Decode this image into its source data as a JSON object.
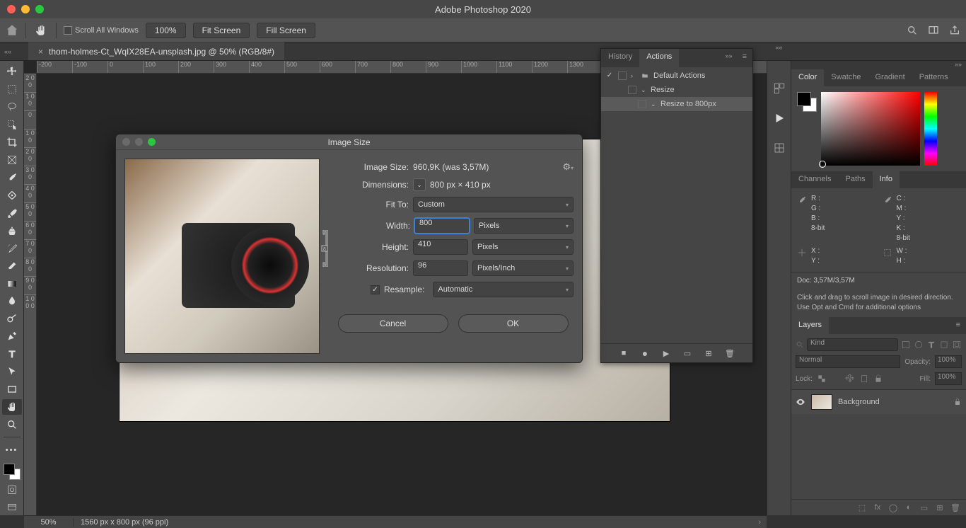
{
  "app": {
    "title": "Adobe Photoshop 2020"
  },
  "options": {
    "scroll_all": "Scroll All Windows",
    "zoom_pct": "100%",
    "fit_screen": "Fit Screen",
    "fill_screen": "Fill Screen"
  },
  "document": {
    "tab_title": "thom-holmes-Ct_WqIX28EA-unsplash.jpg @ 50% (RGB/8#)"
  },
  "ruler_h": [
    "-200",
    "-100",
    "0",
    "100",
    "200",
    "300",
    "400",
    "500",
    "600",
    "700",
    "800",
    "900",
    "1000",
    "1100",
    "1200",
    "1300"
  ],
  "ruler_v": [
    "2 0 0",
    "1 0 0",
    "0",
    "1 0 0",
    "2 0 0",
    "3 0 0",
    "4 0 0",
    "5 0 0",
    "6 0 0",
    "7 0 0",
    "8 0 0",
    "9 0 0",
    "1 0 0 0"
  ],
  "actions": {
    "tab_history": "History",
    "tab_actions": "Actions",
    "items": [
      {
        "label": "Default Actions",
        "indent": 0,
        "check": true,
        "folder": true,
        "arrow": "›"
      },
      {
        "label": "Resize",
        "indent": 1,
        "check": false,
        "folder": false,
        "arrow": "⌄"
      },
      {
        "label": "Resize to 800px",
        "indent": 2,
        "check": false,
        "folder": false,
        "arrow": "⌄",
        "selected": true
      }
    ]
  },
  "dialog": {
    "title": "Image Size",
    "size_label": "Image Size:",
    "size_value": "960,9K (was 3,57M)",
    "dim_label": "Dimensions:",
    "dim_value": "800 px  ×  410 px",
    "fit_label": "Fit To:",
    "fit_value": "Custom",
    "width_label": "Width:",
    "width_value": "800",
    "width_unit": "Pixels",
    "height_label": "Height:",
    "height_value": "410",
    "height_unit": "Pixels",
    "res_label": "Resolution:",
    "res_value": "96",
    "res_unit": "Pixels/Inch",
    "resample_label": "Resample:",
    "resample_value": "Automatic",
    "cancel": "Cancel",
    "ok": "OK"
  },
  "color_panel": {
    "tabs": [
      "Color",
      "Swatche",
      "Gradient",
      "Patterns"
    ],
    "active": 0
  },
  "info_panel": {
    "tabs": [
      "Channels",
      "Paths",
      "Info"
    ],
    "active": 2,
    "rgb": {
      "R": "R :",
      "G": "G :",
      "B": "B :",
      "bits": "8-bit"
    },
    "cmyk": {
      "C": "C :",
      "M": "M :",
      "Y": "Y :",
      "K": "K :",
      "bits": "8-bit"
    },
    "xy": {
      "X": "X :",
      "Y": "Y :"
    },
    "wh": {
      "W": "W :",
      "H": "H :"
    },
    "doc": "Doc: 3,57M/3,57M",
    "hint": "Click and drag to scroll image in desired direction.  Use Opt and Cmd for additional options"
  },
  "layers_panel": {
    "tab": "Layers",
    "kind": "Kind",
    "blend": "Normal",
    "opacity_lbl": "Opacity:",
    "opacity": "100%",
    "lock_lbl": "Lock:",
    "fill_lbl": "Fill:",
    "fill": "100%",
    "layer_name": "Background"
  },
  "status": {
    "zoom": "50%",
    "info": "1560 px x 800 px (96 ppi)"
  }
}
